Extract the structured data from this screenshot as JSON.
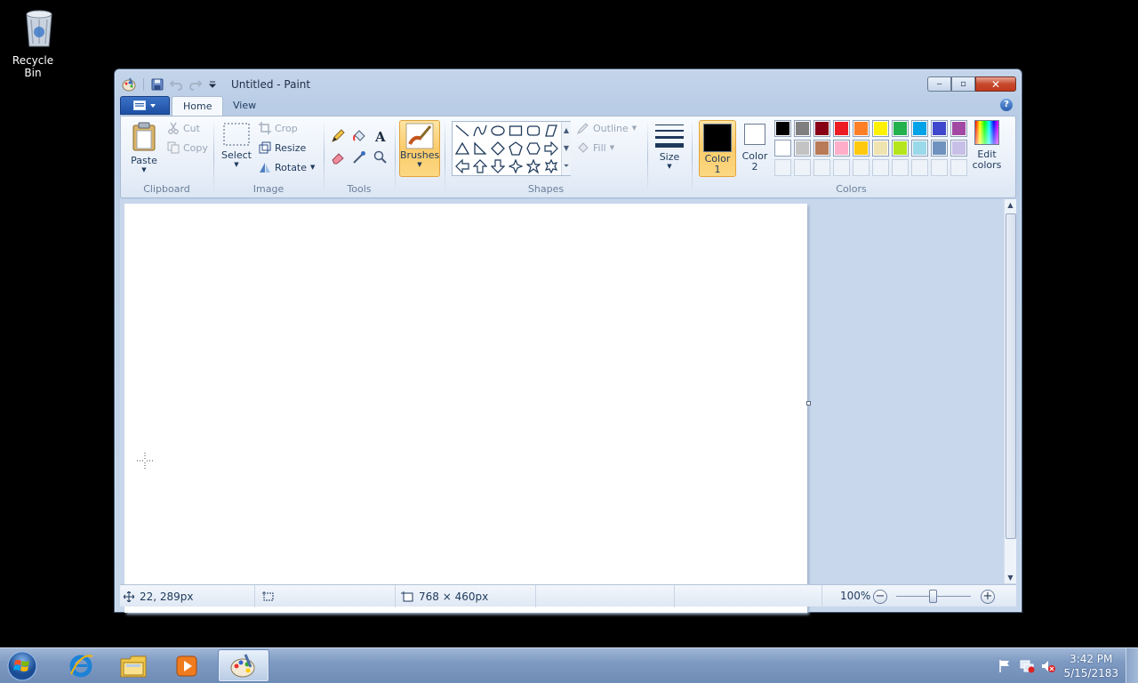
{
  "desktop": {
    "recycle_bin_label": "Recycle Bin"
  },
  "window": {
    "title": "Untitled - Paint",
    "btn_min": "‒",
    "btn_max": "▫",
    "btn_close": "✕"
  },
  "tabs": [
    {
      "label": "Home"
    },
    {
      "label": "View"
    }
  ],
  "help": "?",
  "clipboard": {
    "group": "Clipboard",
    "paste": "Paste",
    "cut": "Cut",
    "copy": "Copy"
  },
  "image": {
    "group": "Image",
    "select": "Select",
    "crop": "Crop",
    "resize": "Resize",
    "rotate": "Rotate"
  },
  "tools": {
    "group": "Tools"
  },
  "brushes": {
    "label": "Brushes"
  },
  "shapes": {
    "group": "Shapes",
    "outline": "Outline",
    "fill": "Fill"
  },
  "size": {
    "label": "Size"
  },
  "colors": {
    "group": "Colors",
    "color1_l1": "Color",
    "color1_l2": "1",
    "color2_l1": "Color",
    "color2_l2": "2",
    "edit_l1": "Edit",
    "edit_l2": "colors",
    "color1": "#000000",
    "color2": "#ffffff",
    "row1": [
      "#000000",
      "#7f7f7f",
      "#880015",
      "#ed1c24",
      "#ff7f27",
      "#fff200",
      "#22b14c",
      "#00a2e8",
      "#3f48cc",
      "#a349a4"
    ],
    "row2": [
      "#ffffff",
      "#c3c3c3",
      "#b97a57",
      "#ffaec9",
      "#ffc90e",
      "#efe4b0",
      "#b5e61d",
      "#99d9ea",
      "#7092be",
      "#c8bfe7"
    ]
  },
  "status": {
    "cursor_pos": "22, 289px",
    "selection_size": "",
    "canvas_size": "768 × 460px",
    "zoom": "100%",
    "zoom_minus": "−",
    "zoom_plus": "+"
  },
  "taskbar": {
    "items": [
      {
        "name": "internet-explorer"
      },
      {
        "name": "windows-explorer"
      },
      {
        "name": "media-player"
      },
      {
        "name": "paint"
      }
    ],
    "time": "3:42 PM",
    "date": "5/15/2183"
  }
}
